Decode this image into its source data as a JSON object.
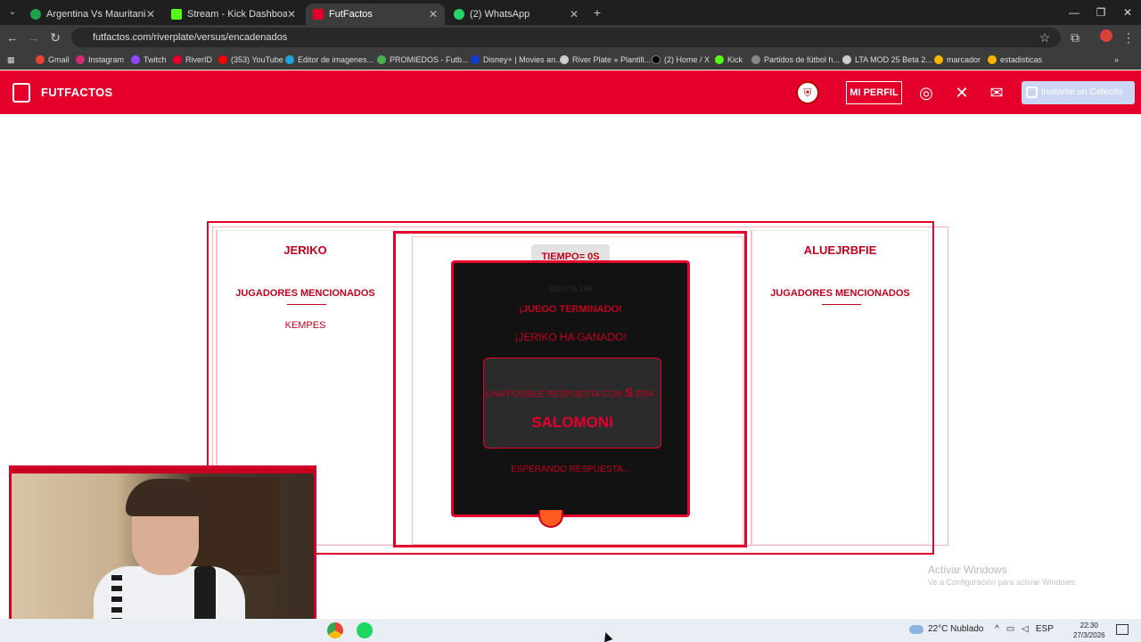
{
  "browser": {
    "tabs": [
      {
        "title": "Argentina Vs Mauritania - Resu",
        "favicon_color": "#22a04a"
      },
      {
        "title": "Stream - Kick Dashboard",
        "favicon_color": "#53fc18"
      },
      {
        "title": "FutFactos",
        "favicon_color": "#e4002b"
      },
      {
        "title": "(2) WhatsApp",
        "favicon_color": "#25d366"
      }
    ],
    "url": "futfactos.com/riverplate/versus/encadenados",
    "bookmarks": [
      {
        "label": "Gmail",
        "color": "#ea4335"
      },
      {
        "label": "Instagram",
        "color": "#d62976"
      },
      {
        "label": "Twitch",
        "color": "#9146ff"
      },
      {
        "label": "RiverID",
        "color": "#e4002b"
      },
      {
        "label": "(353) YouTube",
        "color": "#ff0000"
      },
      {
        "label": "Editor de imagenes...",
        "color": "#1fa3e0"
      },
      {
        "label": "PROMIEDOS - Futb...",
        "color": "#4caf50"
      },
      {
        "label": "Disney+ | Movies an...",
        "color": "#113ccf"
      },
      {
        "label": "River Plate » Plantill...",
        "color": "#cccccc"
      },
      {
        "label": "(2) Home / X",
        "color": "#000000"
      },
      {
        "label": "Kick",
        "color": "#53fc18"
      },
      {
        "label": "Partidos de fútbol h...",
        "color": "#888888"
      },
      {
        "label": "LTA MOD 25 Beta 2...",
        "color": "#cccccc"
      },
      {
        "label": "marcador",
        "color": "#f5b400"
      },
      {
        "label": "estadisticas",
        "color": "#f5b400"
      }
    ]
  },
  "site": {
    "title": "FUTFACTOS",
    "profile_button": "MI PERFIL",
    "cafecito_button": "Invitame un Cafecito"
  },
  "game": {
    "timer": "TIEMPO= 0S",
    "player_left": {
      "name": "JERIKO",
      "mentioned_label": "JUGADORES MENCIONADOS",
      "players": [
        "KEMPES"
      ]
    },
    "player_right": {
      "name": "ALUEJRBFIE",
      "mentioned_label": "JUGADORES MENCIONADOS",
      "players": []
    },
    "modal": {
      "background_text": "SIENTA 186",
      "game_over": "¡JUEGO TERMINADO!",
      "winner": "¡JERIKO HA GANADO!",
      "answer_lead": "UNA POSIBLE RESPUESTA CON",
      "answer_letter": "S",
      "answer_suffix": "ERA -",
      "answer_name": "SALOMONI",
      "waiting": "ESPERANDO RESPUESTA..."
    }
  },
  "windows": {
    "activate_title": "Activar Windows",
    "activate_sub": "Ve a Configuración para activar Windows.",
    "weather": "22°C  Nublado",
    "lang": "ESP",
    "time": "22:30",
    "date": "27/3/2026"
  }
}
